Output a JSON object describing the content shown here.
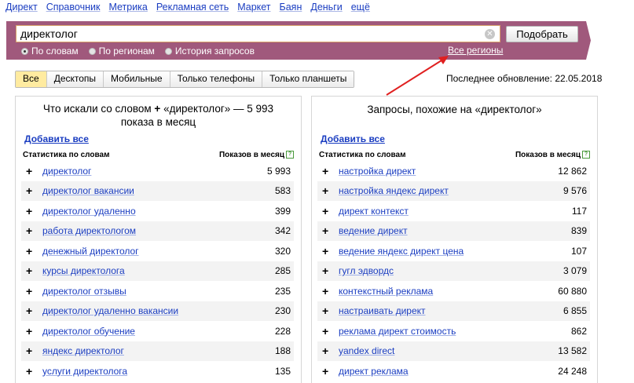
{
  "topnav": [
    "Директ",
    "Справочник",
    "Метрика",
    "Рекламная сеть",
    "Маркет",
    "Баян",
    "Деньги",
    "ещё"
  ],
  "search": {
    "value": "директолог",
    "button": "Подобрать",
    "modes": [
      "По словам",
      "По регионам",
      "История запросов"
    ],
    "selected_mode": "По словам",
    "regions_link": "Все регионы"
  },
  "tabs": [
    "Все",
    "Десктопы",
    "Мобильные",
    "Только телефоны",
    "Только планшеты"
  ],
  "active_tab": "Все",
  "last_update": "Последнее обновление: 22.05.2018",
  "left_panel": {
    "title_line1_pre": "Что искали со словом",
    "title_plus": "+",
    "title_line1_post": "«директолог» — 5 993",
    "title_line2": "показа в месяц",
    "add_all": "Добавить все",
    "col_words": "Статистика по словам",
    "col_shows": "Показов в месяц",
    "rows": [
      {
        "kw": "директолог",
        "count": "5 993"
      },
      {
        "kw": "директолог вакансии",
        "count": "583"
      },
      {
        "kw": "директолог удаленно",
        "count": "399"
      },
      {
        "kw": "работа директологом",
        "count": "342"
      },
      {
        "kw": "денежный директолог",
        "count": "320"
      },
      {
        "kw": "курсы директолога",
        "count": "285"
      },
      {
        "kw": "директолог отзывы",
        "count": "235"
      },
      {
        "kw": "директолог удаленно вакансии",
        "count": "230"
      },
      {
        "kw": "директолог обучение",
        "count": "228"
      },
      {
        "kw": "яндекс директолог",
        "count": "188"
      },
      {
        "kw": "услуги директолога",
        "count": "135"
      }
    ]
  },
  "right_panel": {
    "title": "Запросы, похожие на «директолог»",
    "add_all": "Добавить все",
    "col_words": "Статистика по словам",
    "col_shows": "Показов в месяц",
    "rows": [
      {
        "kw": "настройка директ",
        "count": "12 862"
      },
      {
        "kw": "настройка яндекс директ",
        "count": "9 576"
      },
      {
        "kw": "директ контекст",
        "count": "117"
      },
      {
        "kw": "ведение директ",
        "count": "839"
      },
      {
        "kw": "ведение яндекс директ цена",
        "count": "107"
      },
      {
        "kw": "гугл эдвордс",
        "count": "3 079"
      },
      {
        "kw": "контекстный реклама",
        "count": "60 880"
      },
      {
        "kw": "настраивать директ",
        "count": "6 855"
      },
      {
        "kw": "реклама директ стоимость",
        "count": "862"
      },
      {
        "kw": "yandex direct",
        "count": "13 582"
      },
      {
        "kw": "директ реклама",
        "count": "24 248"
      }
    ]
  },
  "colors": {
    "band": "#a0597c",
    "link": "#1a3dc1",
    "active_tab": "#ffeba0",
    "arrow": "#e02020"
  },
  "icons": [
    "clear-icon",
    "help-icon",
    "plus-icon",
    "radio-icon"
  ]
}
